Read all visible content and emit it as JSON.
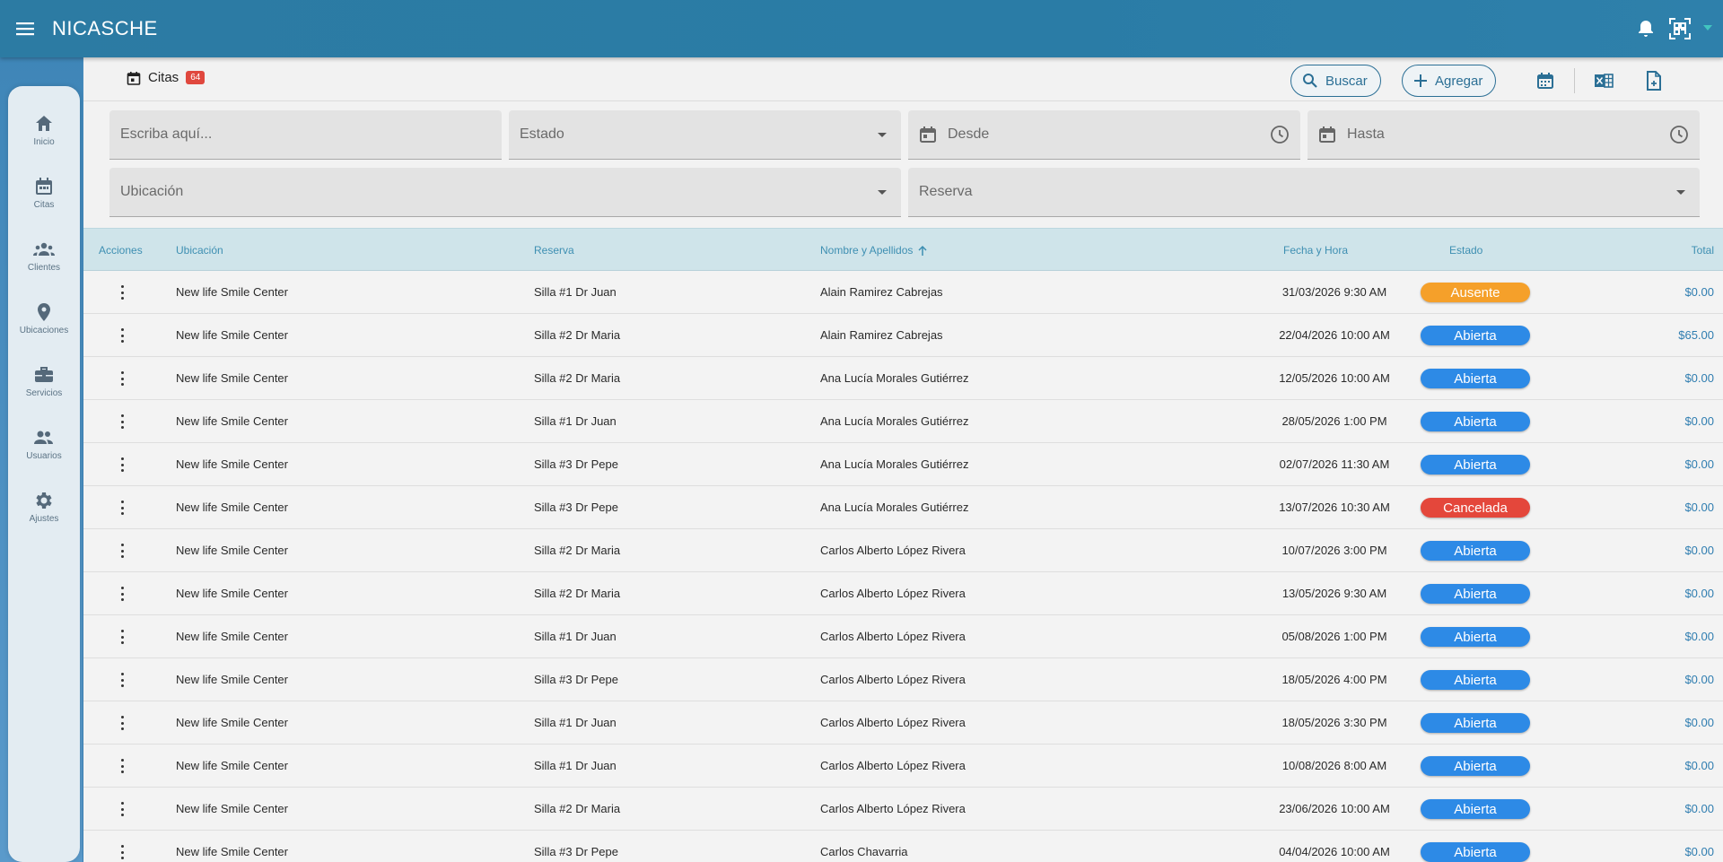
{
  "app": {
    "title": "NICASCHE"
  },
  "colors": {
    "accent": "#2b7ba5",
    "status_abierta": "#2d8ae6",
    "status_ausente": "#f5a02a",
    "status_cancelada": "#e4473b"
  },
  "sidebar": {
    "items": [
      {
        "label": "Inicio",
        "icon": "home-icon"
      },
      {
        "label": "Citas",
        "icon": "calendar-icon"
      },
      {
        "label": "Clientes",
        "icon": "group-icon"
      },
      {
        "label": "Ubicaciones",
        "icon": "location-pin-icon"
      },
      {
        "label": "Servicios",
        "icon": "briefcase-icon"
      },
      {
        "label": "Usuarios",
        "icon": "users-icon"
      },
      {
        "label": "Ajustes",
        "icon": "gear-icon"
      }
    ]
  },
  "toolbar": {
    "section": "Citas",
    "count": "64",
    "search_label": "Buscar",
    "add_label": "Agregar"
  },
  "filters": {
    "search_placeholder": "Escriba aquí...",
    "estado": "Estado",
    "desde": "Desde",
    "hasta": "Hasta",
    "ubicacion": "Ubicación",
    "reserva": "Reserva"
  },
  "table": {
    "headers": {
      "acciones": "Acciones",
      "ubicacion": "Ubicación",
      "reserva": "Reserva",
      "nombre": "Nombre y Apellidos",
      "fecha": "Fecha y Hora",
      "estado": "Estado",
      "total": "Total"
    },
    "rows": [
      {
        "ubicacion": "New life Smile Center",
        "reserva": "Silla #1 Dr Juan",
        "nombre": "Alain Ramirez Cabrejas",
        "fecha": "31/03/2026 9:30 AM",
        "estado": "Ausente",
        "total": "$0.00"
      },
      {
        "ubicacion": "New life Smile Center",
        "reserva": "Silla #2 Dr Maria",
        "nombre": "Alain Ramirez Cabrejas",
        "fecha": "22/04/2026 10:00 AM",
        "estado": "Abierta",
        "total": "$65.00"
      },
      {
        "ubicacion": "New life Smile Center",
        "reserva": "Silla #2 Dr Maria",
        "nombre": "Ana Lucía Morales Gutiérrez",
        "fecha": "12/05/2026 10:00 AM",
        "estado": "Abierta",
        "total": "$0.00"
      },
      {
        "ubicacion": "New life Smile Center",
        "reserva": "Silla #1 Dr Juan",
        "nombre": "Ana Lucía Morales Gutiérrez",
        "fecha": "28/05/2026 1:00 PM",
        "estado": "Abierta",
        "total": "$0.00"
      },
      {
        "ubicacion": "New life Smile Center",
        "reserva": "Silla #3 Dr Pepe",
        "nombre": "Ana Lucía Morales Gutiérrez",
        "fecha": "02/07/2026 11:30 AM",
        "estado": "Abierta",
        "total": "$0.00"
      },
      {
        "ubicacion": "New life Smile Center",
        "reserva": "Silla #3 Dr Pepe",
        "nombre": "Ana Lucía Morales Gutiérrez",
        "fecha": "13/07/2026 10:30 AM",
        "estado": "Cancelada",
        "total": "$0.00"
      },
      {
        "ubicacion": "New life Smile Center",
        "reserva": "Silla #2 Dr Maria",
        "nombre": "Carlos Alberto López Rivera",
        "fecha": "10/07/2026 3:00 PM",
        "estado": "Abierta",
        "total": "$0.00"
      },
      {
        "ubicacion": "New life Smile Center",
        "reserva": "Silla #2 Dr Maria",
        "nombre": "Carlos Alberto López Rivera",
        "fecha": "13/05/2026 9:30 AM",
        "estado": "Abierta",
        "total": "$0.00"
      },
      {
        "ubicacion": "New life Smile Center",
        "reserva": "Silla #1 Dr Juan",
        "nombre": "Carlos Alberto López Rivera",
        "fecha": "05/08/2026 1:00 PM",
        "estado": "Abierta",
        "total": "$0.00"
      },
      {
        "ubicacion": "New life Smile Center",
        "reserva": "Silla #3 Dr Pepe",
        "nombre": "Carlos Alberto López Rivera",
        "fecha": "18/05/2026 4:00 PM",
        "estado": "Abierta",
        "total": "$0.00"
      },
      {
        "ubicacion": "New life Smile Center",
        "reserva": "Silla #1 Dr Juan",
        "nombre": "Carlos Alberto López Rivera",
        "fecha": "18/05/2026 3:30 PM",
        "estado": "Abierta",
        "total": "$0.00"
      },
      {
        "ubicacion": "New life Smile Center",
        "reserva": "Silla #1 Dr Juan",
        "nombre": "Carlos Alberto López Rivera",
        "fecha": "10/08/2026 8:00 AM",
        "estado": "Abierta",
        "total": "$0.00"
      },
      {
        "ubicacion": "New life Smile Center",
        "reserva": "Silla #2 Dr Maria",
        "nombre": "Carlos Alberto López Rivera",
        "fecha": "23/06/2026 10:00 AM",
        "estado": "Abierta",
        "total": "$0.00"
      },
      {
        "ubicacion": "New life Smile Center",
        "reserva": "Silla #3 Dr Pepe",
        "nombre": "Carlos Chavarria",
        "fecha": "04/04/2026 10:00 AM",
        "estado": "Abierta",
        "total": "$0.00"
      }
    ]
  }
}
